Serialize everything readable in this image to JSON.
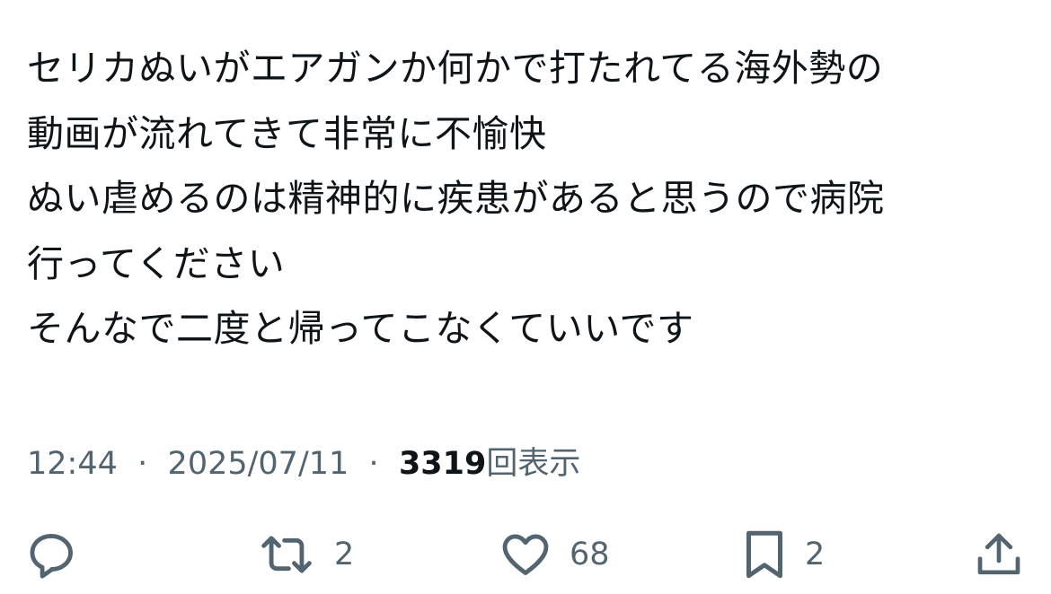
{
  "tweet": {
    "lines": [
      "セリカぬいがエアガンか何かで打たれてる海外勢の",
      "動画が流れてきて非常に不愉快",
      "ぬい虐めるのは精神的に疾患があると思うので病院",
      "行ってください",
      "そんなで二度と帰ってこなくていいです"
    ]
  },
  "meta": {
    "time": "12:44",
    "separator": "·",
    "date": "2025/07/11",
    "view_count": "3319",
    "view_label": "回表示"
  },
  "actions": {
    "reply": {
      "icon": "reply-icon",
      "count": ""
    },
    "retweet": {
      "icon": "retweet-icon",
      "count": "2"
    },
    "like": {
      "icon": "heart-icon",
      "count": "68"
    },
    "bookmark": {
      "icon": "bookmark-icon",
      "count": "2"
    },
    "share": {
      "icon": "share-icon",
      "count": ""
    }
  },
  "colors": {
    "text": "#0f1419",
    "secondary": "#536471",
    "background": "#ffffff"
  }
}
